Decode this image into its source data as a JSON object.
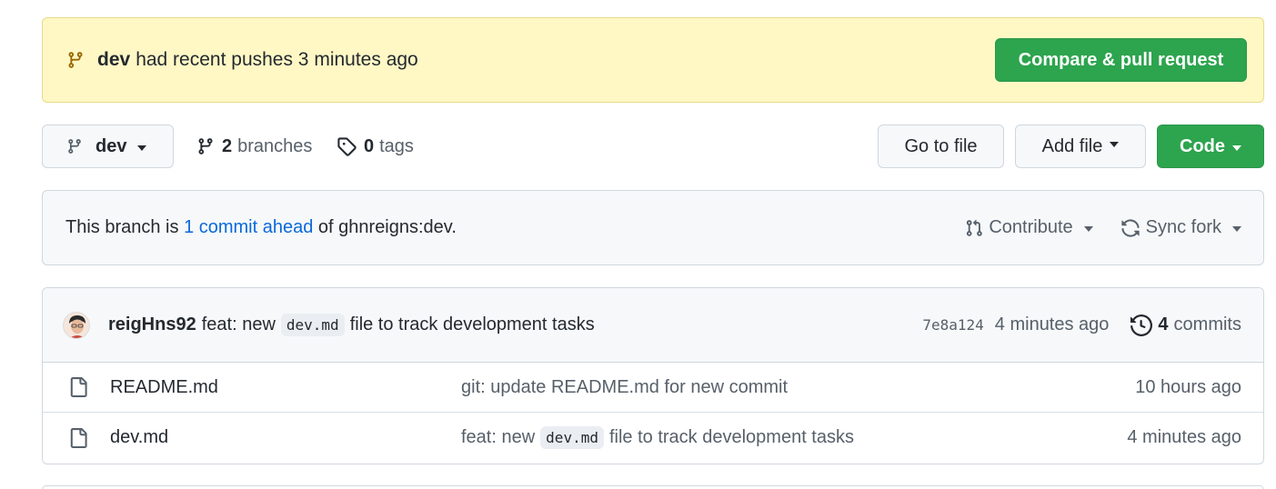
{
  "banner": {
    "branch": "dev",
    "text": "had recent pushes 3 minutes ago",
    "button": "Compare & pull request"
  },
  "toolbar": {
    "branch_label": "dev",
    "branches_count": "2",
    "branches_label": "branches",
    "tags_count": "0",
    "tags_label": "tags",
    "goto_file": "Go to file",
    "add_file": "Add file",
    "code": "Code"
  },
  "status": {
    "prefix": "This branch is",
    "link": "1 commit ahead",
    "suffix": "of ghnreigns:dev.",
    "contribute": "Contribute",
    "sync_fork": "Sync fork"
  },
  "latest_commit": {
    "author": "reigHns92",
    "message_prefix": "feat: new",
    "message_code": "dev.md",
    "message_suffix": "file to track development tasks",
    "sha": "7e8a124",
    "time": "4 minutes ago",
    "commits_count": "4",
    "commits_label": "commits"
  },
  "files": [
    {
      "name": "README.md",
      "message_prefix": "git: update README.md for new commit",
      "message_code": "",
      "message_suffix": "",
      "time": "10 hours ago"
    },
    {
      "name": "dev.md",
      "message_prefix": "feat: new",
      "message_code": "dev.md",
      "message_suffix": "file to track development tasks",
      "time": "4 minutes ago"
    }
  ],
  "colors": {
    "green": "#2da44e",
    "banner_bg": "#fff8c5",
    "link_blue": "#0969da"
  },
  "icons": [
    "git-branch-icon",
    "tag-icon",
    "git-pull-request-icon",
    "sync-icon",
    "history-icon",
    "file-icon"
  ]
}
